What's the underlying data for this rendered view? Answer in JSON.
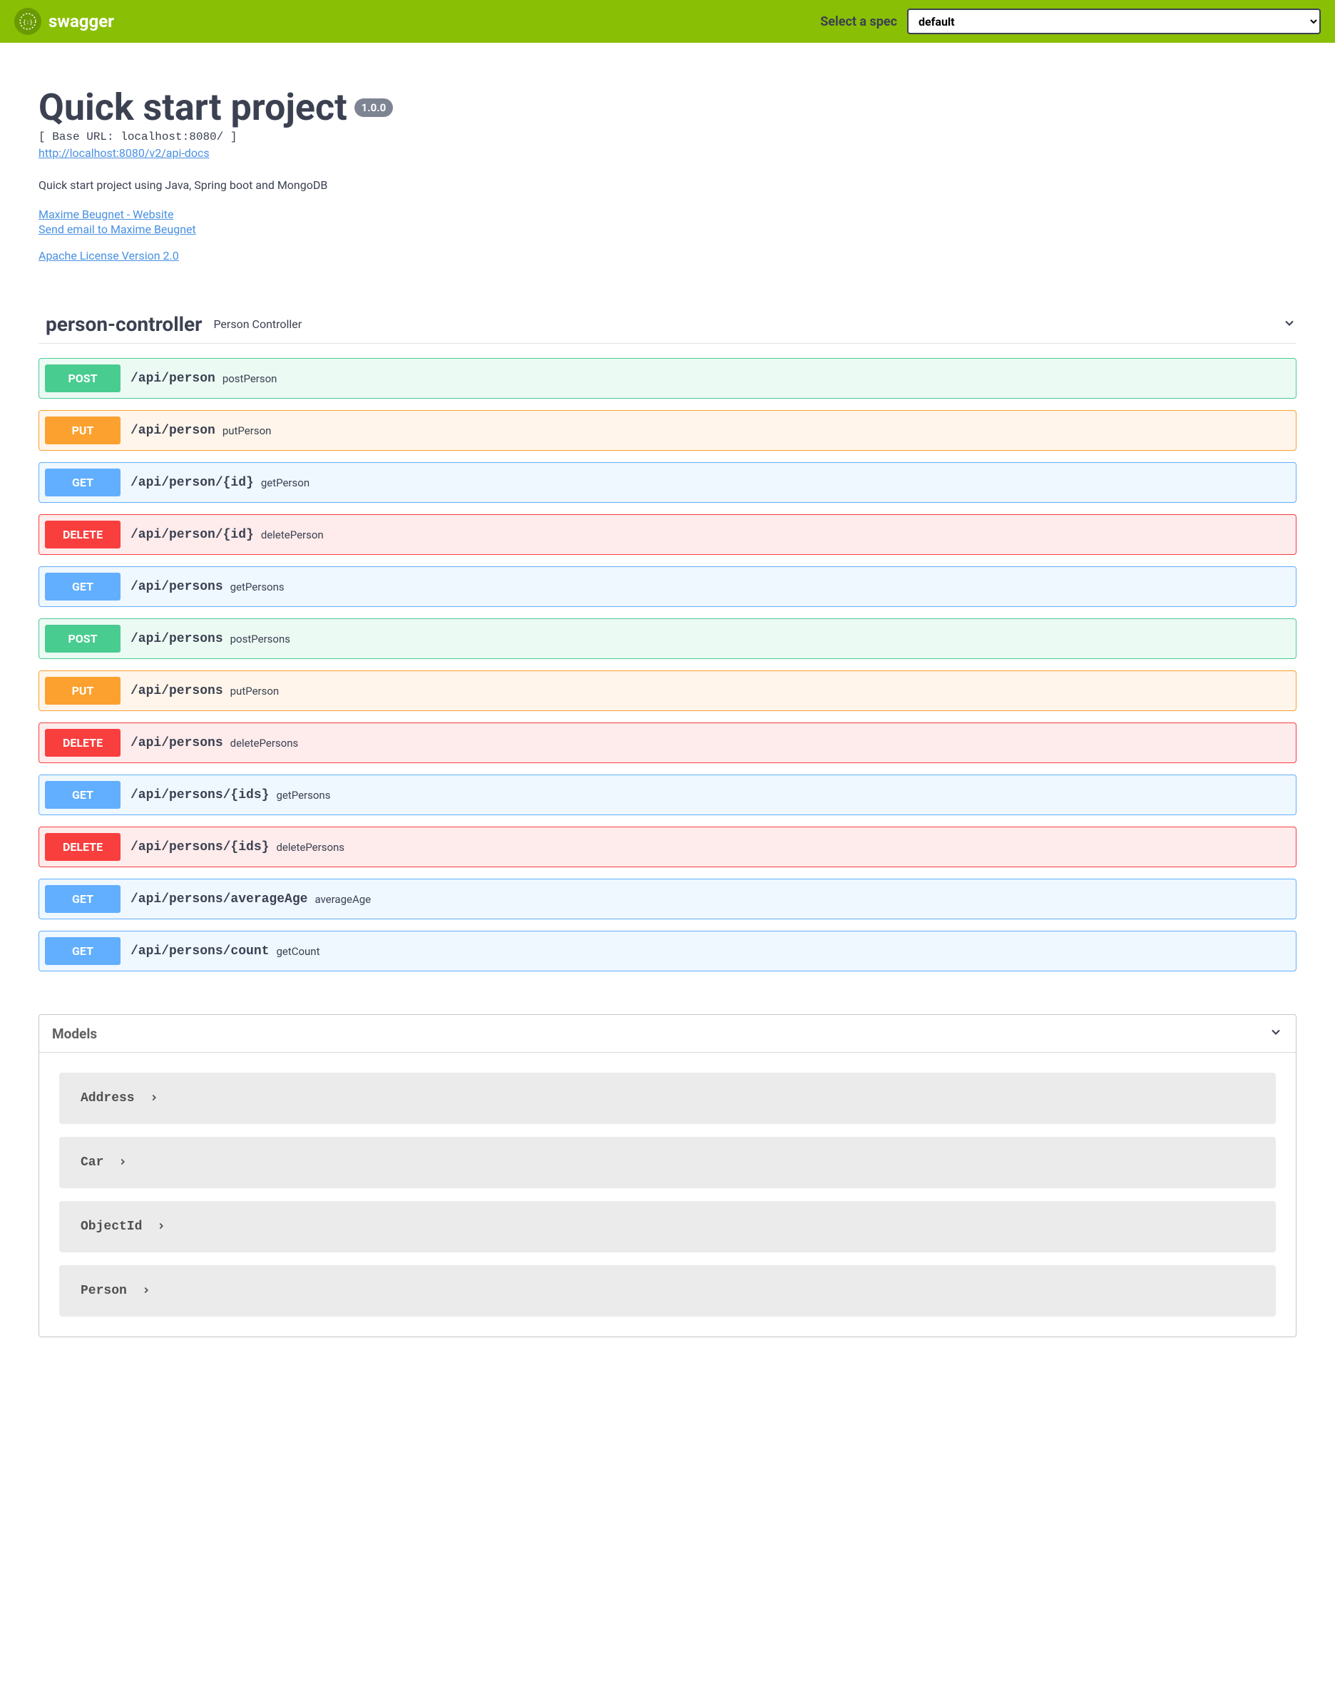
{
  "topbar": {
    "brand": "swagger",
    "select_label": "Select a spec",
    "spec_value": "default"
  },
  "info": {
    "title": "Quick start project",
    "version": "1.0.0",
    "base_url": "[ Base URL: localhost:8080/ ]",
    "api_docs_url": "http://localhost:8080/v2/api-docs",
    "description": "Quick start project using Java, Spring boot and MongoDB",
    "contact_website": "Maxime Beugnet - Website",
    "contact_email": "Send email to Maxime Beugnet",
    "license": "Apache License Version 2.0"
  },
  "tag": {
    "name": "person-controller",
    "description": "Person Controller"
  },
  "operations": [
    {
      "method": "POST",
      "path": "/api/person",
      "summary": "postPerson",
      "class": "opblock-post"
    },
    {
      "method": "PUT",
      "path": "/api/person",
      "summary": "putPerson",
      "class": "opblock-put"
    },
    {
      "method": "GET",
      "path": "/api/person/{id}",
      "summary": "getPerson",
      "class": "opblock-get"
    },
    {
      "method": "DELETE",
      "path": "/api/person/{id}",
      "summary": "deletePerson",
      "class": "opblock-delete"
    },
    {
      "method": "GET",
      "path": "/api/persons",
      "summary": "getPersons",
      "class": "opblock-get"
    },
    {
      "method": "POST",
      "path": "/api/persons",
      "summary": "postPersons",
      "class": "opblock-post"
    },
    {
      "method": "PUT",
      "path": "/api/persons",
      "summary": "putPerson",
      "class": "opblock-put"
    },
    {
      "method": "DELETE",
      "path": "/api/persons",
      "summary": "deletePersons",
      "class": "opblock-delete"
    },
    {
      "method": "GET",
      "path": "/api/persons/{ids}",
      "summary": "getPersons",
      "class": "opblock-get"
    },
    {
      "method": "DELETE",
      "path": "/api/persons/{ids}",
      "summary": "deletePersons",
      "class": "opblock-delete"
    },
    {
      "method": "GET",
      "path": "/api/persons/averageAge",
      "summary": "averageAge",
      "class": "opblock-get"
    },
    {
      "method": "GET",
      "path": "/api/persons/count",
      "summary": "getCount",
      "class": "opblock-get"
    }
  ],
  "models": {
    "title": "Models",
    "items": [
      {
        "name": "Address"
      },
      {
        "name": "Car"
      },
      {
        "name": "ObjectId"
      },
      {
        "name": "Person"
      }
    ]
  }
}
